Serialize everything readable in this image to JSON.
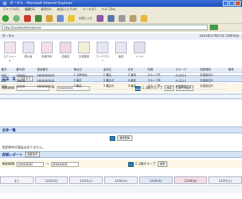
{
  "window": {
    "title": "ポータル - Microsoft Internet Explorer"
  },
  "menu": [
    "ファイル(F)",
    "編集(E)",
    "表示(V)",
    "お気に入り(A)",
    "ツール(T)",
    "ヘルプ(H)"
  ],
  "toolbar": {
    "favorites_label": "お気に入り"
  },
  "address": {
    "url": "http://localhost/html/portal"
  },
  "header": {
    "left": "ポータル",
    "date": "2004年07月07日 12時30分"
  },
  "apps": [
    {
      "label": "スケジュール",
      "color": "#f2e4ef"
    },
    {
      "label": "掲示板",
      "color": "#e8e4f4"
    },
    {
      "label": "設備予約",
      "color": "#f4dfe8"
    },
    {
      "label": "会議室",
      "color": "#f1d9e2"
    },
    {
      "label": "文書管理",
      "color": "#f4f0d8"
    },
    {
      "label": "ワークフロー",
      "color": "#e6e8f4"
    },
    {
      "label": "施設",
      "color": "#ece4f1"
    },
    {
      "label": "メール",
      "color": "#e8dfee"
    }
  ],
  "sub_label": "ページ選択",
  "section1": {
    "title": "設備一覧",
    "button": "検索条件"
  },
  "search_row": {
    "label": "検索期間",
    "from": "",
    "sep": "〜",
    "to": "2004/0630",
    "group": "C 3施グループ",
    "btn_search": "検索",
    "btn_clear": "条件を解除"
  },
  "table": {
    "headers": [
      "番号",
      "番号ID",
      "登録番号",
      "貸出日",
      "返却日",
      "氏名",
      "所属",
      "グループ",
      "保管場所",
      "備考"
    ],
    "rows": [
      [
        "005",
        "10025",
        "0000000002",
        "1 日時持出",
        "1 備品",
        "2 借用",
        "グループA",
        "A-123-1",
        "計量部品A"
      ],
      [
        "006",
        "10028",
        "0000000003",
        "2 備品",
        "3 備品付",
        "4 確認",
        "グループB",
        "A-123-1",
        "計量部品A"
      ],
      [
        "008",
        "10029",
        "0000000004",
        "2 備品",
        "3 備品付",
        "4 確認",
        "グループB",
        "A-123-2",
        "計量部品A"
      ]
    ]
  },
  "section2": {
    "title": "全体一覧",
    "button": "検索条件"
  },
  "center_button_1": "検索更新",
  "message": "指定條件の施設はありません。",
  "section3": {
    "title": "詳細レポート",
    "button": "検索条件"
  },
  "search_row2": {
    "label": "検索期間",
    "from": "2004/0630",
    "sep": "〜",
    "to": "2004/0630",
    "group": "C 3施グループ",
    "btn": "検索"
  },
  "tabs": [
    {
      "label": "全て",
      "color": "#f4f4f8"
    },
    {
      "label": "12/02(月)",
      "color": "#eef0f6"
    },
    {
      "label": "12/03(火)",
      "color": "#eef0f6"
    },
    {
      "label": "12/04(水)",
      "color": "#eef0f6"
    },
    {
      "label": "12/05(木)",
      "color": "#dfe8f6"
    },
    {
      "label": "12/06(金)",
      "color": "#f4dfe4"
    },
    {
      "label": "12/07(土)",
      "color": "#eef0f6"
    }
  ]
}
